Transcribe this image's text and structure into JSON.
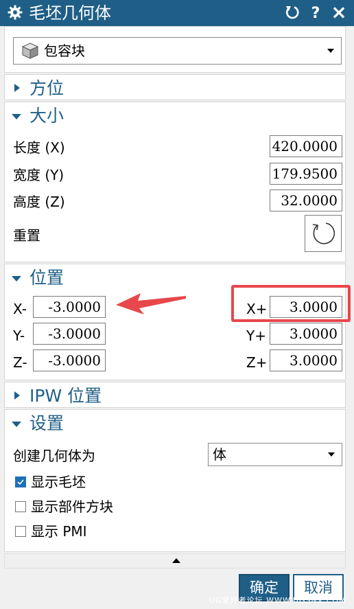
{
  "window": {
    "title": "毛坯几何体",
    "icons": [
      "gear-icon",
      "reset-icon",
      "help-icon",
      "close-icon"
    ],
    "help_glyph": "?",
    "close_glyph": "×"
  },
  "type_select": {
    "value": "包容块",
    "icon": "cube-icon"
  },
  "sections": {
    "orientation": {
      "label": "方位",
      "expanded": false
    },
    "size": {
      "label": "大小",
      "expanded": true
    },
    "position": {
      "label": "位置",
      "expanded": true
    },
    "ipw_position": {
      "label": "IPW 位置",
      "expanded": false
    },
    "settings": {
      "label": "设置",
      "expanded": true
    }
  },
  "size": {
    "length_label": "长度 (X)",
    "length_value": "420.0000",
    "width_label": "宽度 (Y)",
    "width_value": "179.9500",
    "height_label": "高度 (Z)",
    "height_value": "32.0000",
    "reset_label": "重置"
  },
  "position": {
    "x_minus_label": "X-",
    "x_minus_value": "-3.0000",
    "y_minus_label": "Y-",
    "y_minus_value": "-3.0000",
    "z_minus_label": "Z-",
    "z_minus_value": "-3.0000",
    "x_plus_label": "X+",
    "x_plus_value": "3.0000",
    "y_plus_label": "Y+",
    "y_plus_value": "3.0000",
    "z_plus_label": "Z+",
    "z_plus_value": "3.0000"
  },
  "settings": {
    "create_as_label": "创建几何体为",
    "create_as_value": "体",
    "show_blank_label": "显示毛坯",
    "show_blank_checked": true,
    "show_part_box_label": "显示部件方块",
    "show_part_box_checked": false,
    "show_pmi_label": "显示 PMI",
    "show_pmi_checked": false
  },
  "footer": {
    "ok_label": "确定",
    "cancel_label": "取消"
  },
  "watermark": "UG爱好者论坛 WWW.UGSNX.COM",
  "colors": {
    "title_bar": "#1f5f87",
    "accent": "#1f5f87",
    "annotation": "#e8474b"
  }
}
